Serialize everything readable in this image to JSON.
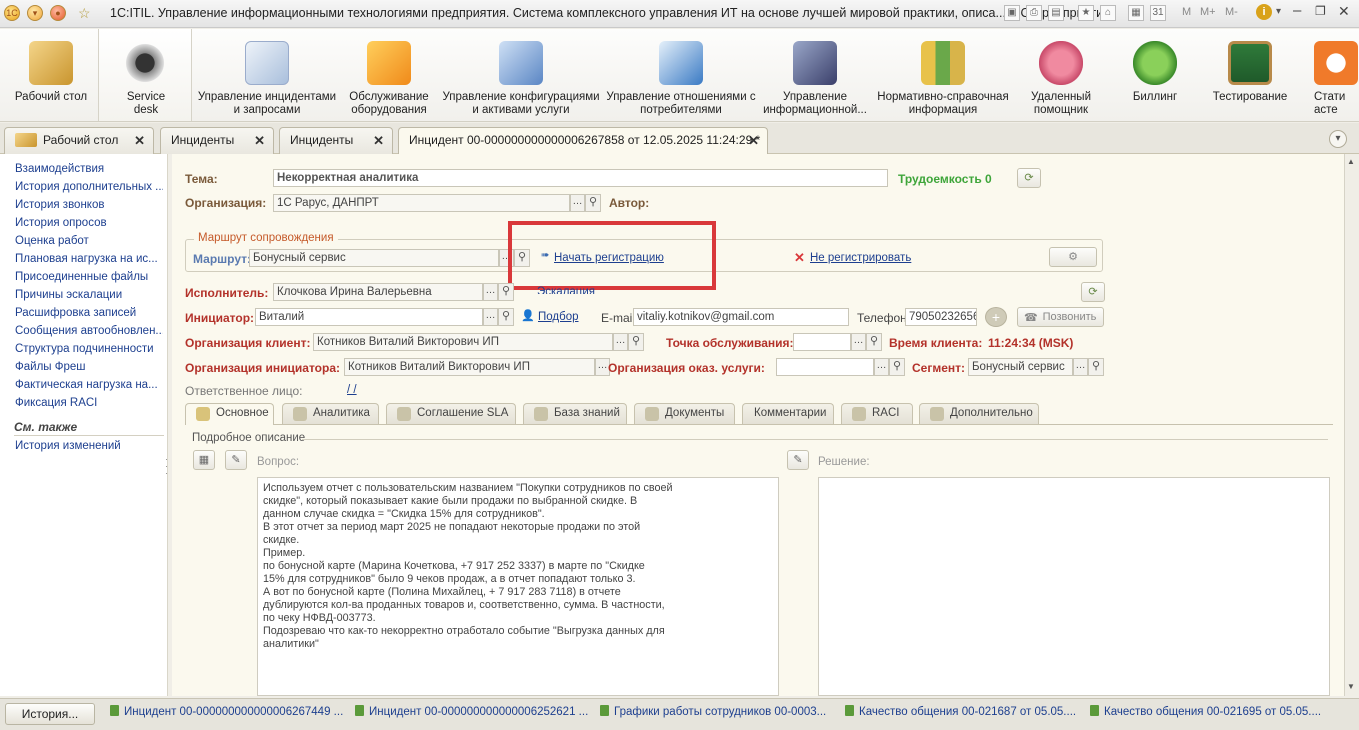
{
  "titlebar": {
    "text": "1С:ITIL. Управление информационными технологиями предприятия. Система комплексного управления ИТ на основе лучшей мировой практики, описа... (1С:Предприятие)",
    "m": "M",
    "mplus": "M+",
    "mminus": "M-"
  },
  "sections": [
    {
      "label": "Рабочий стол",
      "name": "desktop"
    },
    {
      "label": "Service desk",
      "name": "service-desk"
    },
    {
      "label": "Управление инцидентами и запросами",
      "name": "incidents"
    },
    {
      "label": "Обслуживание оборудования",
      "name": "equipment"
    },
    {
      "label": "Управление конфигурациями и активами услуги",
      "name": "config"
    },
    {
      "label": "Управление отношениями с потребителями",
      "name": "relations"
    },
    {
      "label": "Управление информационной...",
      "name": "infosec"
    },
    {
      "label": "Нормативно-справочная информация",
      "name": "reference"
    },
    {
      "label": "Удаленный помощник",
      "name": "remote"
    },
    {
      "label": "Биллинг",
      "name": "billing"
    },
    {
      "label": "Тестирование",
      "name": "testing"
    },
    {
      "label": "Стати асте",
      "name": "stats"
    }
  ],
  "tabs": [
    "Рабочий стол",
    "Инциденты",
    "Инциденты",
    "Инцидент 00-000000000000006267858 от 12.05.2025 11:24:29 *"
  ],
  "leftnav": [
    "Взаимодействия",
    "История дополнительных ...",
    "История звонков",
    "История опросов",
    "Оценка работ",
    "Плановая нагрузка на ис...",
    "Присоединенные файлы",
    "Причины эскалации",
    "Расшифровка записей",
    "Сообщения автообновлен...",
    "Структура подчиненности",
    "Файлы Фреш",
    "Фактическая нагрузка на...",
    "Фиксация RACI"
  ],
  "seealso": {
    "title": "См. также",
    "items": [
      "История изменений"
    ]
  },
  "form": {
    "tema_label": "Тема:",
    "tema": "Некорректная аналитика",
    "labor_label": "Трудоемкость 0",
    "org_label": "Организация:",
    "org": "1С Рарус, ДАНПРТ",
    "author_label": "Автор:",
    "route_group": "Маршрут сопровождения",
    "route_label": "Маршрут:",
    "route": "Бонусный сервис",
    "start_reg": "Начать регистрацию",
    "no_reg": "Не регистрировать",
    "executor_label": "Исполнитель:",
    "executor": "Клочкова Ирина Валерьевна",
    "escalation": "Эскалация",
    "initiator_label": "Инициатор:",
    "initiator": "Виталий",
    "pick": "Подбор",
    "email_label": "E-mail:",
    "email": "vitaliy.kotnikov@gmail.com",
    "phone_label": "Телефон:",
    "phone": "79050232656",
    "call": "Позвонить",
    "client_org_label": "Организация клиент:",
    "client_org": "Котников Виталий Викторович ИП",
    "point_label": "Точка обслуживания:",
    "client_time_label": "Время клиента:",
    "client_time": "11:24:34 (MSK)",
    "init_org_label": "Организация инициатора:",
    "init_org": "Котников Виталий Викторович ИП",
    "svc_org_label": "Организация оказ. услуги:",
    "segment_label": "Сегмент:",
    "segment": "Бонусный сервис",
    "resp_label": "Ответственное лицо:",
    "resp": "/ /",
    "ftabs": [
      "Основное",
      "Аналитика",
      "Соглашение SLA",
      "База знаний",
      "Документы",
      "Комментарии",
      "RACI",
      "Дополнительно"
    ],
    "desc_group": "Подробное описание",
    "question_label": "Вопрос:",
    "solution_label": "Решение:",
    "question_lines": [
      "Используем отчет с пользовательским названием \"Покупки сотрудников по своей",
      "скидке\", который показывает какие были продажи по выбранной скидке. В",
      "данном случае скидка = \"Скидка 15% для сотрудников\".",
      "В этот отчет за период март 2025 не попадают некоторые продажи по этой",
      "скидке.",
      "Пример.",
      "по бонусной карте (Марина Кочеткова, +7 917 252 3337) в марте по \"Скидке",
      "15% для сотрудников\" было 9 чеков продаж, а в отчет попадают только 3.",
      "А вот по бонусной карте (Полина Михайлец, + 7 917 283 7118) в отчете",
      "дублируются кол-ва проданных товаров и, соответственно, сумма. В частности,",
      "по чеку НФВД-003773.",
      "Подозреваю что как-то некорректно отработало событие \"Выгрузка данных для",
      "аналитики\""
    ]
  },
  "taskbar": {
    "history": "История...",
    "items": [
      "Инцидент 00-000000000000006267449 ...",
      "Инцидент 00-000000000000006252621 ...",
      "Графики работы сотрудников 00-0003...",
      "Качество общения 00-021687 от 05.05....",
      "Качество общения 00-021695 от 05.05...."
    ]
  },
  "colors": {
    "accent_red": "#d9383a",
    "label_brown": "#7a5a3a",
    "link_blue": "#1d3f8f",
    "required_red": "#b3322a",
    "labor_green": "#3ea53a"
  }
}
